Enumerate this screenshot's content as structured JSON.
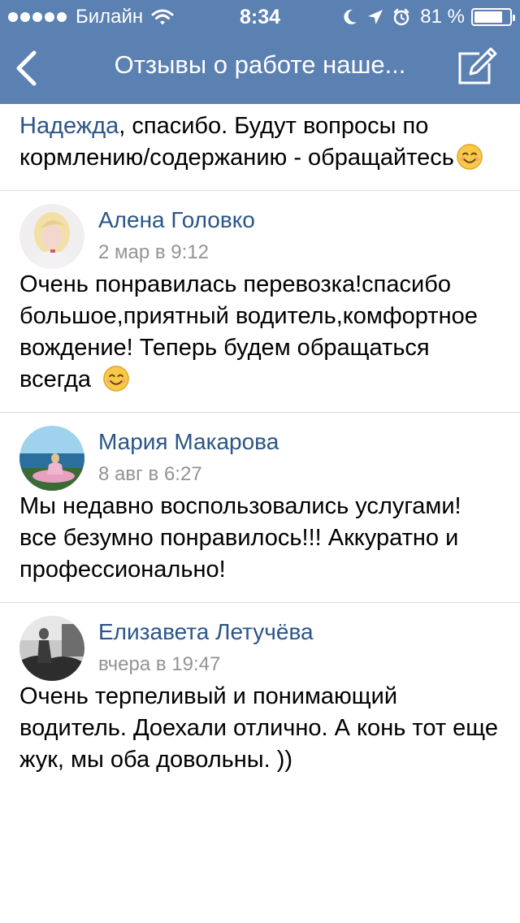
{
  "status_bar": {
    "carrier": "Билайн",
    "time": "8:34",
    "battery_percent": "81 %",
    "battery_level": 0.81,
    "icons": [
      "signal-dots-icon",
      "wifi-icon",
      "moon-icon",
      "location-arrow-icon",
      "alarm-clock-icon",
      "battery-icon"
    ]
  },
  "nav": {
    "title": "Отзывы о работе наше...",
    "back_icon": "chevron-left-icon",
    "compose_icon": "compose-icon"
  },
  "colors": {
    "header_bg": "#5b80b2",
    "link": "#2b5587",
    "meta": "#939393",
    "divider": "#dcdcdc"
  },
  "comments": {
    "first": {
      "mention": "Надежда",
      "text": ", спасибо. Будут вопросы по кормлению/содержанию - обращайтесь",
      "emoji": "smiling-face-emoji"
    },
    "items": [
      {
        "author": "Алена Головко",
        "date": "2 мар в 9:12",
        "text": "Очень понравилась перевозка!спасибо большое,приятный водитель,комфортное вождение! Теперь будем обращаться всегда",
        "emoji": "smiling-face-emoji"
      },
      {
        "author": "Мария Макарова",
        "date": "8 авг в 6:27",
        "text": "Мы недавно воспользовались услугами! все безумно понравилось!!! Аккуратно и профессионально!"
      },
      {
        "author": "Елизавета Летучёва",
        "date": "вчера в 19:47",
        "text": "Очень терпеливый и понимающий водитель. Доехали отлично. А конь тот еще жук, мы оба довольны. ))"
      }
    ]
  }
}
